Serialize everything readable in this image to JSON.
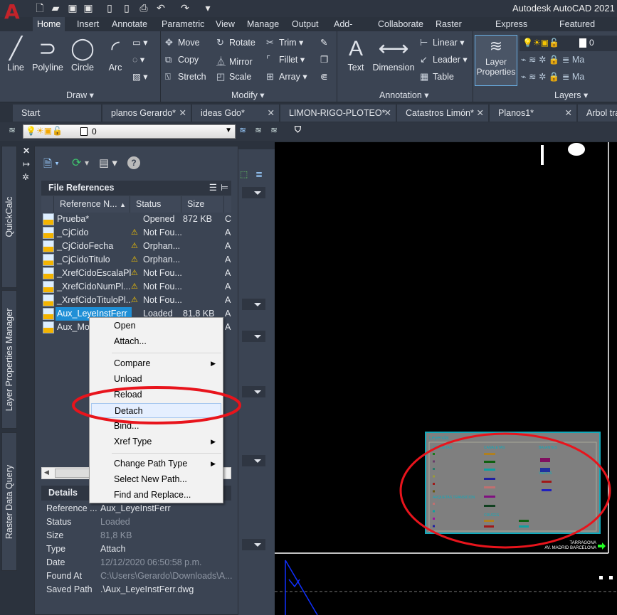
{
  "app": {
    "title": "Autodesk AutoCAD 2021",
    "logo": "A"
  },
  "ribbon_tabs": [
    "Home",
    "Insert",
    "Annotate",
    "Parametric",
    "View",
    "Manage",
    "Output",
    "Add-ins",
    "Collaborate",
    "Raster Tools",
    "Express Tools",
    "Featured Apps"
  ],
  "ribbon": {
    "draw": {
      "label": "Draw",
      "tools": [
        "Line",
        "Polyline",
        "Circle",
        "Arc"
      ]
    },
    "modify": {
      "label": "Modify",
      "tools": [
        "Move",
        "Rotate",
        "Trim",
        "Copy",
        "Mirror",
        "Fillet",
        "Stretch",
        "Scale",
        "Array"
      ]
    },
    "annotation": {
      "label": "Annotation",
      "tools": [
        "Text",
        "Dimension",
        "Linear",
        "Leader",
        "Table"
      ]
    },
    "layers": {
      "label": "Layers",
      "layer_properties": "Layer Properties",
      "current_layer": "0",
      "more1": "Ma",
      "more2": "Ma"
    }
  },
  "doc_tabs": [
    "Start",
    "planos Gerardo*",
    "ideas Gdo*",
    "LIMON-RIGO-PLOTEO*",
    "Catastros Limón*",
    "Planos1*",
    "Arbol tra"
  ],
  "toolbar": {
    "layer_value": "0"
  },
  "side_tabs": [
    "QuickCalc",
    "Layer Properties Manager",
    "Raster Data Query"
  ],
  "file_references": {
    "title": "File References",
    "columns": [
      "Reference N...",
      "Status",
      "Size"
    ],
    "rows": [
      {
        "name": "Prueba*",
        "status": "Opened",
        "size": "872 KB",
        "type": "C",
        "warn": false
      },
      {
        "name": "_CjCido",
        "status": "Not Fou...",
        "size": "",
        "type": "A",
        "warn": true
      },
      {
        "name": "_CjCidoFecha",
        "status": "Orphan...",
        "size": "",
        "type": "A",
        "warn": true
      },
      {
        "name": "_CjCidoTitulo",
        "status": "Orphan...",
        "size": "",
        "type": "A",
        "warn": true
      },
      {
        "name": "_XrefCidoEscalaPl...",
        "status": "Not Fou...",
        "size": "",
        "type": "A",
        "warn": true
      },
      {
        "name": "_XrefCidoNumPl...",
        "status": "Not Fou...",
        "size": "",
        "type": "A",
        "warn": true
      },
      {
        "name": "_XrefCidoTituloPl...",
        "status": "Not Fou...",
        "size": "",
        "type": "A",
        "warn": true
      },
      {
        "name": "Aux_LeyeInstFerr",
        "status": "Loaded",
        "size": "81,8 KB",
        "type": "A",
        "warn": false,
        "selected": true
      },
      {
        "name": "Aux_Mor",
        "status": "",
        "size": "",
        "type": "A",
        "warn": true
      }
    ]
  },
  "details": {
    "title": "Details",
    "rows": [
      {
        "key": "Reference ...",
        "value": "Aux_LeyeInstFerr",
        "dim": false
      },
      {
        "key": "Status",
        "value": "Loaded",
        "dim": true
      },
      {
        "key": "Size",
        "value": "81,8 KB",
        "dim": true
      },
      {
        "key": "Type",
        "value": "Attach",
        "dim": false
      },
      {
        "key": "Date",
        "value": "12/12/2020 06:50:58 p.m.",
        "dim": true
      },
      {
        "key": "Found At",
        "value": "C:\\Users\\Gerardo\\Downloads\\A...",
        "dim": true
      },
      {
        "key": "Saved Path",
        "value": ".\\Aux_LeyeInstFerr.dwg",
        "dim": false
      }
    ]
  },
  "context_menu": [
    {
      "label": "Open"
    },
    {
      "label": "Attach..."
    },
    {
      "sep": true
    },
    {
      "label": "Compare",
      "submenu": true
    },
    {
      "label": "Unload"
    },
    {
      "label": "Reload"
    },
    {
      "label": "Detach",
      "highlighted": true
    },
    {
      "label": "Bind..."
    },
    {
      "label": "Xref Type",
      "submenu": true
    },
    {
      "sep": true
    },
    {
      "label": "Change Path Type",
      "submenu": true
    },
    {
      "label": "Select New Path..."
    },
    {
      "label": "Find and Replace..."
    }
  ],
  "drawing": {
    "legend_title": "Leyenda:",
    "legend_headers": [
      "ARQUETAS",
      "CANALETAS",
      "BAJANTES",
      "VARIOS",
      "ARQUETAS TRANSICION",
      "CRUCES"
    ],
    "labels": [
      "TARRAGONA",
      "AV. MADRID BARCELONA"
    ]
  },
  "colors": {
    "accent": "#1f8fd6",
    "annotation_red": "#e8141c",
    "panel": "#3b4453",
    "warning": "#f5c400"
  }
}
